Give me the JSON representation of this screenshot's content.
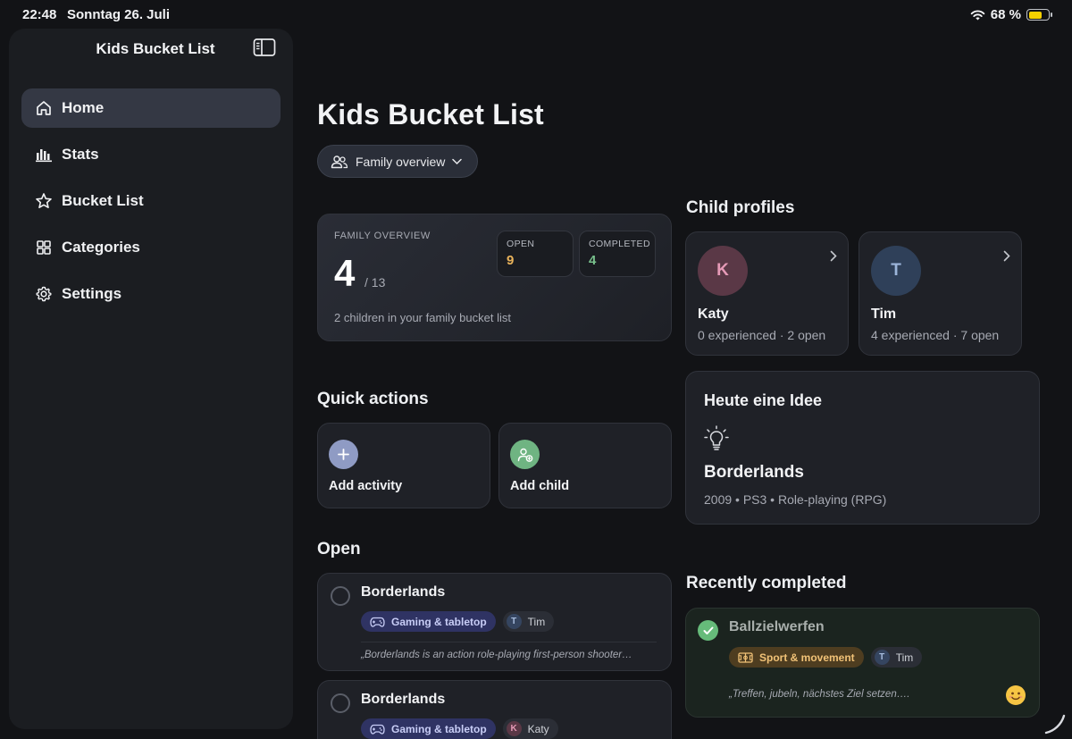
{
  "status_bar": {
    "time": "22:48",
    "date": "Sonntag 26. Juli",
    "battery": "68 %",
    "battery_level": 0.68
  },
  "sidebar": {
    "title": "Kids Bucket List",
    "items": [
      {
        "label": "Home",
        "icon": "home-icon",
        "active": true
      },
      {
        "label": "Stats",
        "icon": "bar-chart-icon"
      },
      {
        "label": "Bucket List",
        "icon": "star-icon"
      },
      {
        "label": "Categories",
        "icon": "grid-icon"
      },
      {
        "label": "Settings",
        "icon": "gear-icon"
      }
    ]
  },
  "main": {
    "title": "Kids Bucket List",
    "family_select": {
      "label": "Family overview",
      "icon": "people-icon"
    },
    "overview": {
      "label": "FAMILY OVERVIEW",
      "completed_count": "4",
      "total": "/ 13",
      "subtitle": "2 children in your family bucket list",
      "open_label": "OPEN",
      "open_value": "9",
      "completed_label": "COMPLETED",
      "completed_value": "4",
      "colors": {
        "open": "#e9b35b",
        "completed": "#78c08c"
      }
    },
    "child_profiles_heading": "Child profiles",
    "children": [
      {
        "initial": "K",
        "name": "Katy",
        "stats": "0 experienced · 2 open",
        "avatar_bg": "#5a3846",
        "avatar_fg": "#e69ab7"
      },
      {
        "initial": "T",
        "name": "Tim",
        "stats": "4 experienced · 7 open",
        "avatar_bg": "#2f4059",
        "avatar_fg": "#9cb5da"
      }
    ],
    "idea": {
      "title": "Heute eine Idee",
      "icon": "lightbulb-icon",
      "name": "Borderlands",
      "meta": "2009 • PS3 • Role-playing (RPG)"
    },
    "quick_actions_heading": "Quick actions",
    "quick_actions": [
      {
        "label": "Add activity",
        "icon": "plus-icon",
        "color": "#8f9bc4"
      },
      {
        "label": "Add child",
        "icon": "add-person-icon",
        "color": "#6fb482"
      }
    ],
    "open_heading": "Open",
    "open_items": [
      {
        "title": "Borderlands",
        "category": "Gaming & tabletop",
        "kid_initial": "T",
        "kid_name": "Tim",
        "description": "„Borderlands is an action role-playing first-person shooter…"
      },
      {
        "title": "Borderlands",
        "category": "Gaming & tabletop",
        "kid_initial": "K",
        "kid_name": "Katy",
        "description": ""
      }
    ],
    "recently_completed_heading": "Recently completed",
    "completed_items": [
      {
        "title": "Ballzielwerfen",
        "category": "Sport & movement",
        "kid_initial": "T",
        "kid_name": "Tim",
        "description": "„Treffen, jubeln, nächstes Ziel setzen….",
        "reaction": "smiling-face-emoji"
      }
    ]
  }
}
